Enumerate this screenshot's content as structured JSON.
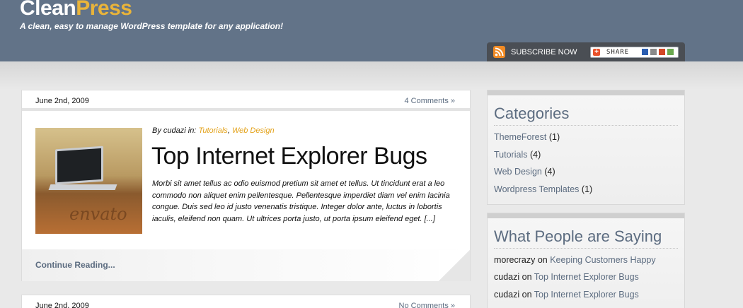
{
  "header": {
    "logo_part1": "Clean",
    "logo_part2": "Press",
    "tagline": "A clean, easy to manage WordPress template for any application!",
    "subscribe_label": "SUBSCRIBE NOW",
    "share_label": "SHARE"
  },
  "posts": [
    {
      "date": "June 2nd, 2009",
      "comments": "4 Comments »",
      "byline_prefix": "By cudazi in:",
      "categories": [
        "Tutorials",
        "Web Design"
      ],
      "category_sep": ",",
      "title": "Top Internet Explorer Bugs",
      "excerpt": "Morbi sit amet tellus ac odio euismod pretium sit amet et tellus. Ut tincidunt erat a leo commodo non aliquet enim pellentesque. Pellentesque imperdiet diam vel enim lacinia congue. Duis sed leo id justo venenatis tristique. Integer dolor ante, luctus in lobortis iaculis, eleifend non quam. Ut ultrices porta justo, ut porta ipsum eleifend eget. [...]",
      "continue_label": "Continue Reading...",
      "thumbnail_watermark": "envato"
    },
    {
      "date": "June 2nd, 2009",
      "comments": "No Comments »"
    }
  ],
  "sidebar": {
    "categories": {
      "title": "Categories",
      "items": [
        {
          "name": "ThemeForest",
          "count": "(1)"
        },
        {
          "name": "Tutorials",
          "count": "(4)"
        },
        {
          "name": "Web Design",
          "count": "(4)"
        },
        {
          "name": "Wordpress Templates",
          "count": "(1)"
        }
      ]
    },
    "comments": {
      "title": "What People are Saying",
      "connector": "on",
      "items": [
        {
          "author": "morecrazy",
          "post": "Keeping Customers Happy"
        },
        {
          "author": "cudazi",
          "post": "Top Internet Explorer Bugs"
        },
        {
          "author": "cudazi",
          "post": "Top Internet Explorer Bugs"
        }
      ]
    }
  },
  "colors": {
    "header_bg": "#627388",
    "accent": "#e9b43a",
    "link": "#5c6c80",
    "category_link": "#e3a21a",
    "rss": "#f08a24"
  }
}
